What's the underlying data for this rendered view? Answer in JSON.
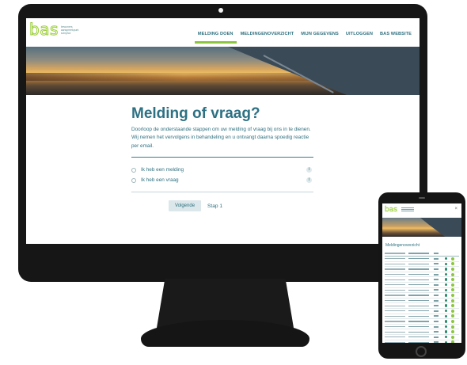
{
  "desktop": {
    "logo": {
      "word": "bas",
      "tagline": "bewoners\naanspreekpunt\nschiphol"
    },
    "nav": [
      {
        "label": "MELDING DOEN",
        "active": true
      },
      {
        "label": "MELDINGENOVERZICHT",
        "active": false
      },
      {
        "label": "MIJN GEGEVENS",
        "active": false
      },
      {
        "label": "UITLOGGEN",
        "active": false
      },
      {
        "label": "BAS WEBSITE",
        "active": false
      }
    ],
    "form": {
      "title": "Melding of vraag?",
      "intro": "Doorloop de onderstaande stappen om uw melding of vraag bij ons in te dienen. Wij nemen het vervolgens in behandeling en u ontvangt daarna spoedig reactie per email.",
      "options": [
        {
          "label": "Ik heb een melding",
          "info": "i"
        },
        {
          "label": "Ik heb een vraag",
          "info": "i"
        }
      ],
      "next_button": "Volgende",
      "step": "Stap 1"
    }
  },
  "phone": {
    "logo": "bas",
    "menu_icon": "close-icon",
    "page_title": "Meldingenoverzicht",
    "row_count": 17
  },
  "colors": {
    "accent_green": "#8cc63f",
    "brand_teal": "#2f7180",
    "device_black": "#161616"
  }
}
